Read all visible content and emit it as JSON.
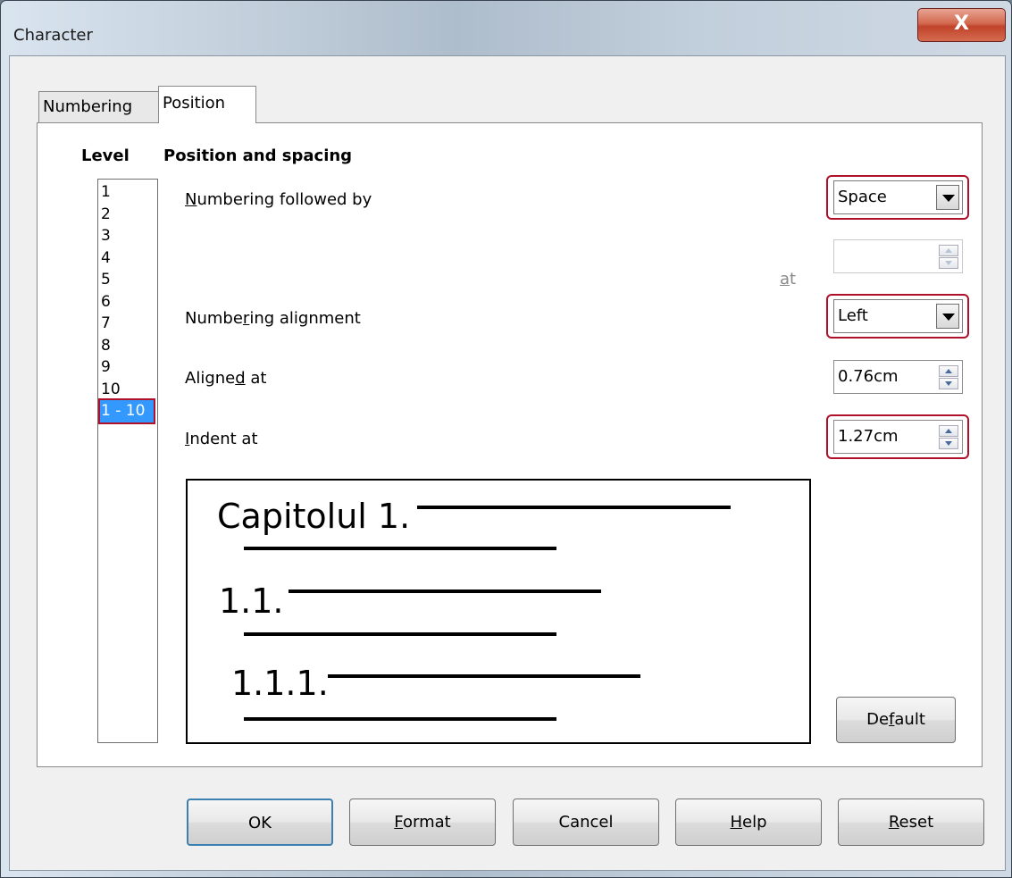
{
  "window": {
    "title": "Character",
    "close_glyph": "X"
  },
  "tabs": [
    {
      "label": "Numbering"
    },
    {
      "label": "Position"
    }
  ],
  "level": {
    "heading": "Level",
    "items": [
      "1",
      "2",
      "3",
      "4",
      "5",
      "6",
      "7",
      "8",
      "9",
      "10",
      "1 - 10"
    ],
    "selected": "1 - 10"
  },
  "position": {
    "heading": "Position and spacing",
    "followed_by": {
      "label_pre": "",
      "label_u": "N",
      "label_post": "umbering followed by",
      "value": "Space"
    },
    "at": {
      "label_u": "a",
      "label_post": "t",
      "value": ""
    },
    "alignment": {
      "label_pre": "Numbe",
      "label_u": "r",
      "label_post": "ing alignment",
      "value": "Left"
    },
    "aligned_at": {
      "label_pre": "Aligne",
      "label_u": "d",
      "label_post": " at",
      "value": "0.76cm"
    },
    "indent_at": {
      "label_pre": "",
      "label_u": "I",
      "label_post": "ndent at",
      "value": "1.27cm"
    }
  },
  "preview": {
    "line1": "Capitolul 1.",
    "line2": "1.1.",
    "line3": "1.1.1."
  },
  "buttons": {
    "default": {
      "pre": "De",
      "u": "f",
      "post": "ault"
    },
    "ok": {
      "pre": "OK",
      "u": "",
      "post": ""
    },
    "format": {
      "pre": "",
      "u": "F",
      "post": "ormat"
    },
    "cancel": {
      "pre": "Cancel",
      "u": "",
      "post": ""
    },
    "help": {
      "pre": "",
      "u": "H",
      "post": "elp"
    },
    "reset": {
      "pre": "",
      "u": "R",
      "post": "eset"
    }
  },
  "colors": {
    "highlight": "#b0102a",
    "selection": "#3399ff",
    "close_button": "#c0432a"
  }
}
